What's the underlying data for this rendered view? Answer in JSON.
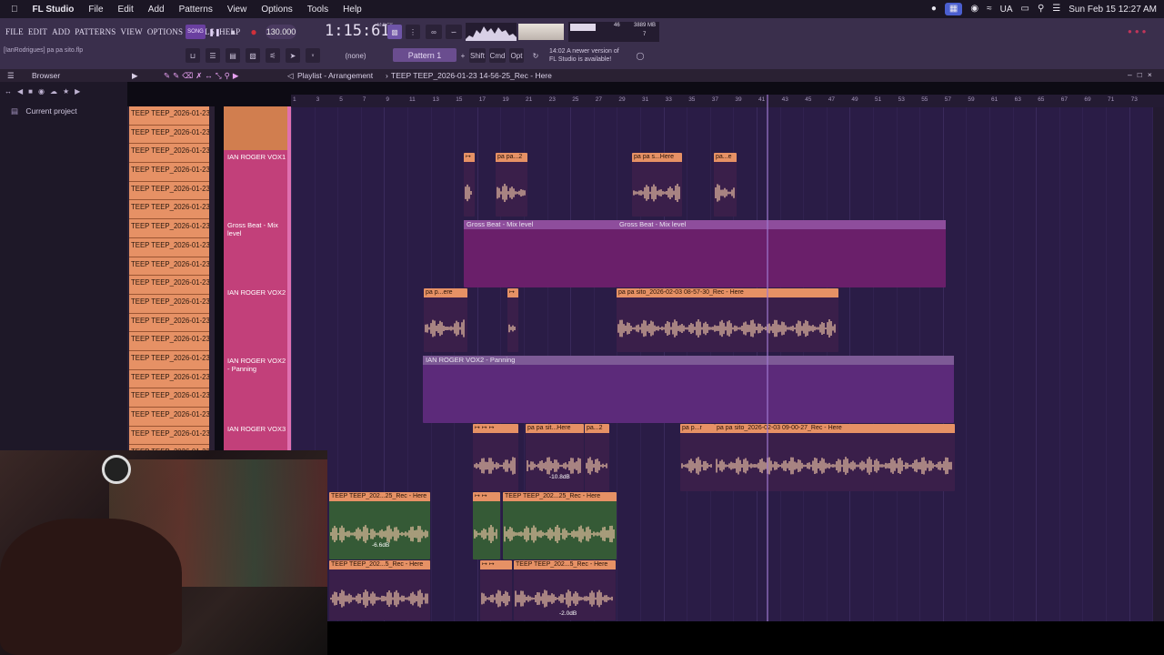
{
  "mac_menubar": {
    "app_name": "FL Studio",
    "items": [
      "File",
      "Edit",
      "Add",
      "Patterns",
      "View",
      "Options",
      "Tools",
      "Help"
    ],
    "right": {
      "input_source": "UA",
      "datetime": "Sun Feb 15  12:27 AM"
    }
  },
  "fl_toolbar": {
    "menu": [
      "FILE",
      "EDIT",
      "ADD",
      "PATTERNS",
      "VIEW",
      "OPTIONS",
      "TOOLS",
      "HELP"
    ],
    "hint": "[IanRodrigues] pa pa sito.flp",
    "song_mode": "SONG",
    "tempo": "130.000",
    "time": "1:15:61",
    "time_unit": "M:S:CS",
    "cpu": "46",
    "memory": "3889 MB",
    "voices": "7",
    "snap": "(none)",
    "pattern": "Pattern 1",
    "buttons": {
      "shift": "Shift",
      "cmd": "Cmd",
      "opt": "Opt"
    },
    "update_notice": [
      "14:02  A newer version of",
      "FL Studio is available!"
    ]
  },
  "playlist": {
    "title": "Playlist - Arrangement",
    "breadcrumb": "TEEP TEEP_2026-01-23 14-56-25_Rec - Here",
    "browser_label": "Browser",
    "browser_tree": [
      "Current project"
    ],
    "ruler": [
      "1",
      "3",
      "5",
      "7",
      "9",
      "11",
      "13",
      "15",
      "17",
      "19",
      "21",
      "23",
      "25",
      "27",
      "29",
      "31",
      "33",
      "35",
      "37",
      "39",
      "41",
      "43",
      "45",
      "47",
      "49",
      "51",
      "53",
      "55",
      "57",
      "59",
      "61",
      "63",
      "65",
      "67",
      "69",
      "71",
      "73"
    ]
  },
  "clip_source": [
    "TEEP TEEP_2026-01-23...",
    "TEEP TEEP_2026-01-23...",
    "TEEP TEEP_2026-01-23...",
    "TEEP TEEP_2026-01-23...",
    "TEEP TEEP_2026-01-23...",
    "TEEP TEEP_2026-01-23...",
    "TEEP TEEP_2026-01-23...",
    "TEEP TEEP_2026-01-23...",
    "TEEP TEEP_2026-01-23...",
    "TEEP TEEP_2026-01-23...",
    "TEEP TEEP_2026-01-23...",
    "TEEP TEEP_2026-01-23...",
    "TEEP TEEP_2026-01-23...",
    "TEEP TEEP_2026-01-23...",
    "TEEP TEEP_2026-01-23...",
    "TEEP TEEP_2026-01-23...",
    "TEEP TEEP_2026-01-23...",
    "TEEP TEEP_2026-01-23...",
    "TEEP TEEP_2026-01-23..."
  ],
  "tracks": [
    {
      "name": "IAN ROGER VOX1"
    },
    {
      "name": "Gross Beat - Mix level"
    },
    {
      "name": "IAN ROGER VOX2"
    },
    {
      "name": "IAN ROGER VOX2 - Panning"
    },
    {
      "name": "IAN ROGER VOX3"
    }
  ],
  "clips": {
    "c1": "pa pa...2",
    "c2": "pa pa s...Here",
    "c3": "pa...e",
    "auto1": "Gross Beat - Mix level",
    "auto2": "Gross Beat - Mix level",
    "c4": "pa p...ere",
    "c5": "pa pa sito_2026-02-03 08-57-30_Rec - Here",
    "auto3": "IAN ROGER VOX2 - Panning",
    "c6": "pa pa sit...Here",
    "c7": "pa...2",
    "c8": "pa p...r",
    "c9": "pa pa sito_2026-02-03 09-00-27_Rec - Here",
    "c10": "TEEP TEEP_202...25_Rec - Here",
    "c11": "TEEP TEEP_202...25_Rec - Here",
    "c12": "TEEP TEEP_202...5_Rec - Here",
    "c13": "TEEP TEEP_202...5_Rec - Here"
  },
  "gains": {
    "g1": "-10.8dB",
    "g2": "-6.6dB",
    "g3": "-2.0dB"
  },
  "colors": {
    "clip_orange": "#e69165",
    "clip_green": "#4e8a4a",
    "track_pink": "#c2407a",
    "automation": "#7a2a86",
    "grid": "#2a1c46"
  }
}
